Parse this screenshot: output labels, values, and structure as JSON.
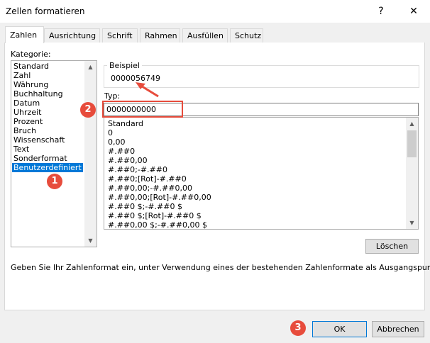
{
  "window": {
    "title": "Zellen formatieren",
    "help_label": "?",
    "close_label": "✕"
  },
  "tabs": [
    {
      "label": "Zahlen",
      "active": true
    },
    {
      "label": "Ausrichtung"
    },
    {
      "label": "Schrift"
    },
    {
      "label": "Rahmen"
    },
    {
      "label": "Ausfüllen"
    },
    {
      "label": "Schutz"
    }
  ],
  "kategorie": {
    "label": "Kategorie:",
    "items": [
      "Standard",
      "Zahl",
      "Währung",
      "Buchhaltung",
      "Datum",
      "Uhrzeit",
      "Prozent",
      "Bruch",
      "Wissenschaft",
      "Text",
      "Sonderformat",
      "Benutzerdefiniert"
    ],
    "selected": "Benutzerdefiniert"
  },
  "beispiel": {
    "label": "Beispiel",
    "value": "0000056749"
  },
  "typ": {
    "label": "Typ:",
    "value": "0000000000",
    "options": [
      "Standard",
      "0",
      "0,00",
      "#.##0",
      "#.##0,00",
      "#.##0;-#.##0",
      "#.##0;[Rot]-#.##0",
      "#.##0,00;-#.##0,00",
      "#.##0,00;[Rot]-#.##0,00",
      "#.##0 $;-#.##0 $",
      "#.##0 $;[Rot]-#.##0 $",
      "#.##0,00 $;-#.##0,00 $"
    ]
  },
  "buttons": {
    "delete": "Löschen",
    "ok": "OK",
    "cancel": "Abbrechen"
  },
  "hint": "Geben Sie Ihr Zahlenformat ein, unter Verwendung eines der bestehenden Zahlenformate als Ausgangspunkt.",
  "annotations": {
    "step1": "1",
    "step2": "2",
    "step3": "3",
    "color": "#e74c3c"
  },
  "colors": {
    "selection": "#0078d7",
    "accent": "#e74c3c"
  }
}
